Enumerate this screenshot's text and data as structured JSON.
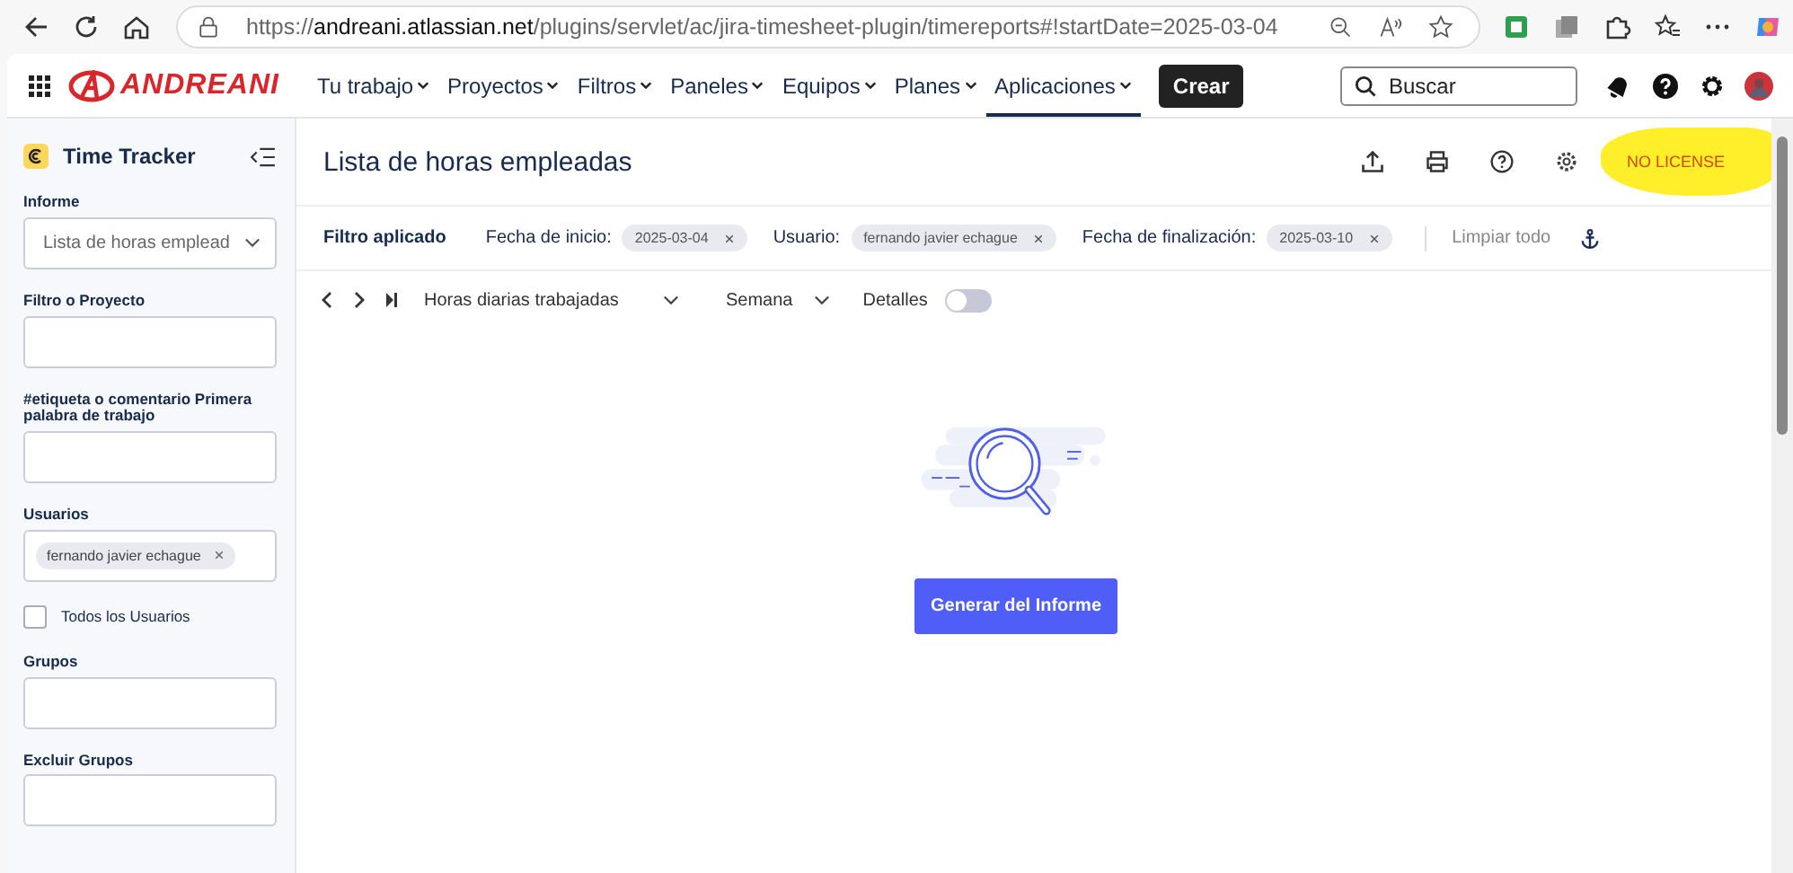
{
  "browser": {
    "url": "https://**andreani.atlassian.net**/plugins/servlet/ac/jira-timesheet-plugin/timereports#!startDate=2025-03-04"
  },
  "nav": {
    "logo": "ANDREANI",
    "items": [
      {
        "label": "Tu trabajo",
        "selected": false
      },
      {
        "label": "Proyectos",
        "selected": false
      },
      {
        "label": "Filtros",
        "selected": false
      },
      {
        "label": "Paneles",
        "selected": false
      },
      {
        "label": "Equipos",
        "selected": false
      },
      {
        "label": "Planes",
        "selected": false
      },
      {
        "label": "Aplicaciones",
        "selected": true
      }
    ],
    "create": "Crear",
    "search": {
      "placeholder": "Buscar"
    }
  },
  "sidebar": {
    "title": "Time Tracker",
    "fields": [
      {
        "kind": "select",
        "label": "Informe",
        "value": "Lista de horas emplead"
      },
      {
        "kind": "input",
        "label": "Filtro o Proyecto"
      },
      {
        "kind": "input",
        "label": "#etiqueta o comentario Primera palabra de trabajo"
      },
      {
        "kind": "tags",
        "label": "Usuarios",
        "tags": [
          "fernando javier echague"
        ]
      },
      {
        "kind": "checkbox",
        "label": "Todos los Usuarios",
        "checked": false
      },
      {
        "kind": "input",
        "label": "Grupos"
      },
      {
        "kind": "input",
        "label": "Excluir Grupos"
      }
    ]
  },
  "main": {
    "title": "Lista de horas empleadas",
    "license": "NO LICENSE",
    "filters": {
      "label": "Filtro aplicado",
      "items": [
        {
          "label": "Fecha de inicio:",
          "value": "2025-03-04"
        },
        {
          "label": "Usuario:",
          "value": "fernando javier echague"
        },
        {
          "label": "Fecha de finalización:",
          "value": "2025-03-10"
        }
      ],
      "clear": "Limpiar todo"
    },
    "controls": {
      "report_type": "Horas diarias trabajadas",
      "period": "Semana",
      "details": {
        "label": "Detalles",
        "on": false
      }
    },
    "button": "Generar del Informe"
  }
}
